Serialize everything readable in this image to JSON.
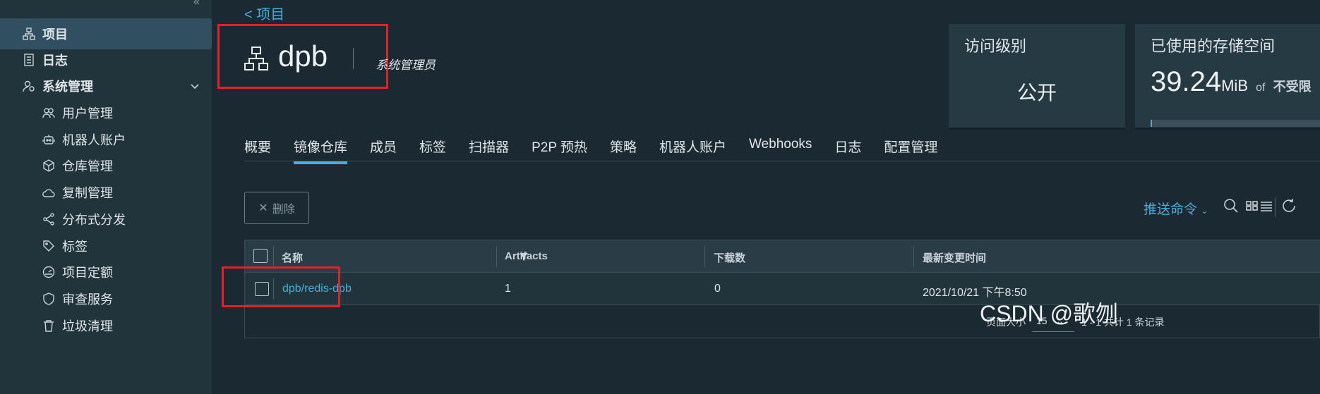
{
  "sidebar": {
    "items": [
      {
        "label": "项目",
        "icon": "project-icon"
      },
      {
        "label": "日志",
        "icon": "log-icon"
      },
      {
        "label": "系统管理",
        "icon": "admin-icon"
      },
      {
        "label": "用户管理",
        "icon": "users-icon"
      },
      {
        "label": "机器人账户",
        "icon": "robot-icon"
      },
      {
        "label": "仓库管理",
        "icon": "cube-icon"
      },
      {
        "label": "复制管理",
        "icon": "cloud-icon"
      },
      {
        "label": "分布式分发",
        "icon": "share-icon"
      },
      {
        "label": "标签",
        "icon": "tag-icon"
      },
      {
        "label": "项目定额",
        "icon": "gauge-icon"
      },
      {
        "label": "审查服务",
        "icon": "shield-icon"
      },
      {
        "label": "垃圾清理",
        "icon": "trash-icon"
      }
    ]
  },
  "header": {
    "back_label": "< 项目",
    "project_name": "dpb",
    "role": "系统管理员"
  },
  "cards": {
    "access": {
      "label": "访问级别",
      "value": "公开"
    },
    "storage": {
      "label": "已使用的存储空间",
      "value": "39.24",
      "unit": "MiB",
      "of": "of",
      "limit": "不受限",
      "fill_fraction": 0.01
    }
  },
  "tabs": [
    "概要",
    "镜像仓库",
    "成员",
    "标签",
    "扫描器",
    "P2P 预热",
    "策略",
    "机器人账户",
    "Webhooks",
    "日志",
    "配置管理"
  ],
  "toolbar": {
    "delete_label": "删除",
    "push_command_label": "推送命令"
  },
  "table": {
    "headers": [
      "名称",
      "Artifacts",
      "下载数",
      "最新变更时间"
    ],
    "rows": [
      {
        "name": "dpb/redis-dpb",
        "artifacts": "1",
        "downloads": "0",
        "updated": "2021/10/21 下午8:50"
      }
    ]
  },
  "pagination": {
    "page_size_label": "页面大小",
    "page_size": "15",
    "summary": "1 - 1 共计 1 条记录"
  },
  "watermark": "CSDN @歌刎",
  "colors": {
    "accent": "#4aaed9",
    "highlight_box": "#e0202a",
    "background": "#1b2a32",
    "sidebar": "#21333b"
  }
}
